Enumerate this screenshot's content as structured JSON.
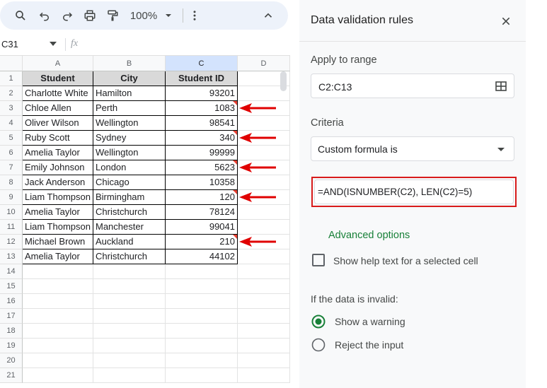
{
  "toolbar": {
    "zoom": "100%",
    "icons": [
      "search-icon",
      "undo-icon",
      "redo-icon",
      "print-icon",
      "paint-format-icon",
      "dropdown-icon",
      "more-icon",
      "collapse-icon"
    ]
  },
  "formula_bar": {
    "cell_ref": "C31",
    "fx": "fx"
  },
  "columns": [
    "A",
    "B",
    "C",
    "D"
  ],
  "rows": [
    [
      "Student",
      "City",
      "Student ID"
    ],
    [
      "Charlotte White",
      "Hamilton",
      "93201"
    ],
    [
      "Chloe Allen",
      "Perth",
      "1083"
    ],
    [
      "Oliver Wilson",
      "Wellington",
      "98541"
    ],
    [
      "Ruby Scott",
      "Sydney",
      "340"
    ],
    [
      "Amelia Taylor",
      "Wellington",
      "99999"
    ],
    [
      "Emily Johnson",
      "London",
      "5623"
    ],
    [
      "Jack Anderson",
      "Chicago",
      "10358"
    ],
    [
      "Liam Thompson",
      "Birmingham",
      "120"
    ],
    [
      "Amelia Taylor",
      "Christchurch",
      "78124"
    ],
    [
      "Liam Thompson",
      "Manchester",
      "99041"
    ],
    [
      "Michael Brown",
      "Auckland",
      "210"
    ],
    [
      "Amelia Taylor",
      "Christchurch",
      "44102"
    ]
  ],
  "row_numbers": [
    "1",
    "2",
    "3",
    "4",
    "5",
    "6",
    "7",
    "8",
    "9",
    "10",
    "11",
    "12",
    "13",
    "14",
    "15",
    "16",
    "17",
    "18",
    "19",
    "20",
    "21"
  ],
  "invalid_rows": [
    3,
    5,
    7,
    9,
    12
  ],
  "panel": {
    "title": "Data validation rules",
    "apply_label": "Apply to range",
    "range_value": "C2:C13",
    "criteria_label": "Criteria",
    "criteria_value": "Custom formula is",
    "formula_value": "=AND(ISNUMBER(C2), LEN(C2)=5)",
    "advanced_options": "Advanced options",
    "help_text_label": "Show help text for a selected cell",
    "invalid_label": "If the data is invalid:",
    "option_warning": "Show a warning",
    "option_reject": "Reject the input"
  },
  "colors": {
    "accent": "#188038",
    "annotation_red": "#e00000",
    "header_fill": "#d9d9d9",
    "selected_col": "#d3e3fd"
  }
}
